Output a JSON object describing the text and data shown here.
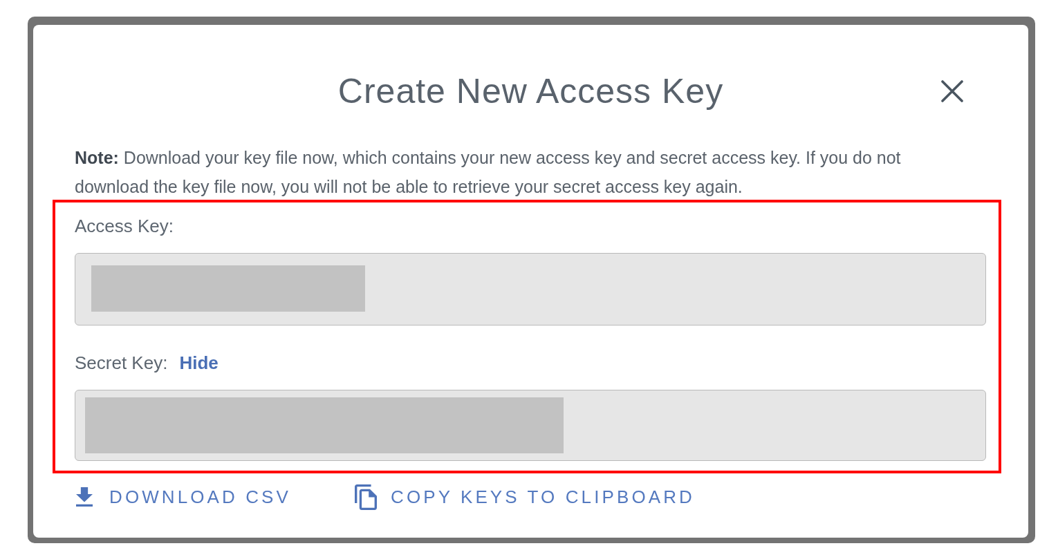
{
  "dialog": {
    "title": "Create New Access Key",
    "note": "**Note:** Download your key file now, which contains your new access key and secret access key. If you do not download the key file now, you will not be able to retrieve your secret access key again.",
    "keys_section": {
      "highlighted": true,
      "fields": [
        {
          "label": "Access Key:",
          "redacted": true
        },
        {
          "label": "Secret Key:",
          "toggle": "Hide",
          "redacted": true
        }
      ]
    },
    "actions": [
      {
        "kind": "download",
        "label": "DOWNLOAD CSV"
      },
      {
        "kind": "copy",
        "label": "COPY KEYS TO CLIPBOARD"
      }
    ]
  }
}
